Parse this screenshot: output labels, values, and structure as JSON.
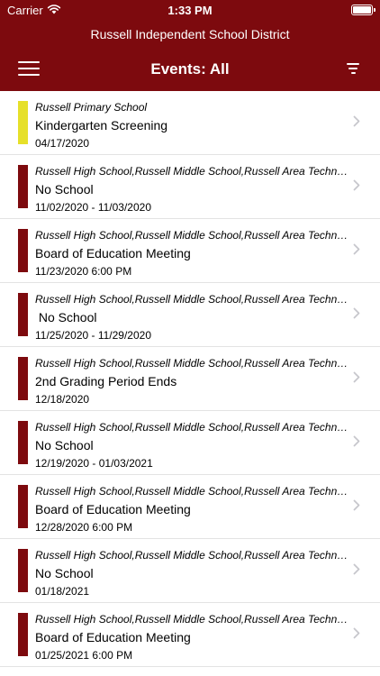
{
  "status": {
    "carrier": "Carrier",
    "time": "1:33 PM"
  },
  "header": {
    "district": "Russell Independent School District",
    "title": "Events: All"
  },
  "colors": {
    "header": "#7d0a0e",
    "yellow": "#e6e02a",
    "maroon": "#7d0a0e"
  },
  "events": [
    {
      "school": "Russell Primary School",
      "name": "Kindergarten Screening",
      "date": "04/17/2020",
      "color": "#e6e02a"
    },
    {
      "school": "Russell High School,Russell Middle School,Russell Area Technology Center",
      "name": "No School",
      "date": "11/02/2020 - 11/03/2020",
      "color": "#7d0a0e"
    },
    {
      "school": "Russell High School,Russell Middle School,Russell Area Technology Center",
      "name": "Board of Education Meeting",
      "date": "11/23/2020 6:00 PM",
      "color": "#7d0a0e"
    },
    {
      "school": "Russell High School,Russell Middle School,Russell Area Technology Center",
      "name": " No School",
      "date": "11/25/2020 - 11/29/2020",
      "color": "#7d0a0e"
    },
    {
      "school": "Russell High School,Russell Middle School,Russell Area Technology Center",
      "name": "2nd Grading Period Ends",
      "date": "12/18/2020",
      "color": "#7d0a0e"
    },
    {
      "school": "Russell High School,Russell Middle School,Russell Area Technology Center",
      "name": "No School",
      "date": "12/19/2020 - 01/03/2021",
      "color": "#7d0a0e"
    },
    {
      "school": "Russell High School,Russell Middle School,Russell Area Technology Center",
      "name": "Board of Education Meeting",
      "date": "12/28/2020 6:00 PM",
      "color": "#7d0a0e"
    },
    {
      "school": "Russell High School,Russell Middle School,Russell Area Technology Center",
      "name": "No School",
      "date": "01/18/2021",
      "color": "#7d0a0e"
    },
    {
      "school": "Russell High School,Russell Middle School,Russell Area Technology Center",
      "name": "Board of Education Meeting",
      "date": "01/25/2021 6:00 PM",
      "color": "#7d0a0e"
    }
  ]
}
